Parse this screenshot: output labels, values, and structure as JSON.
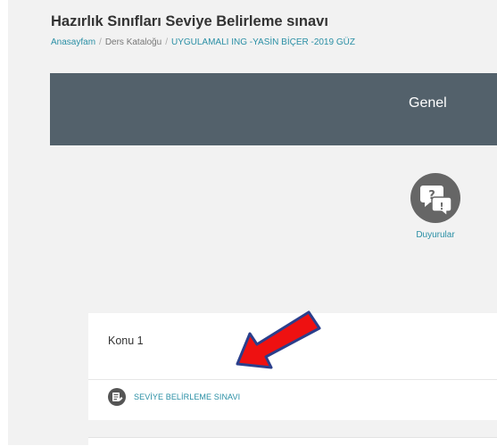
{
  "page": {
    "title": "Hazırlık Sınıfları Seviye Belirleme sınavı"
  },
  "breadcrumb": {
    "items": [
      "Anasayfam",
      "Ders Kataloğu",
      "UYGULAMALI ING -YASİN BİÇER -2019 GÜZ"
    ],
    "separator": "/"
  },
  "tab": {
    "label": "Genel"
  },
  "announcements": {
    "label": "Duyurular",
    "icon": "forum-icon"
  },
  "section": {
    "title": "Konu 1",
    "activity": {
      "label": "SEVİYE BELİRLEME SINAVI",
      "icon": "quiz-icon"
    }
  },
  "colors": {
    "link": "#2a8fa5",
    "banner": "#53616b",
    "page_bg": "#f2f2f2",
    "icon_circle": "#666666",
    "arrow": "#ee1111"
  }
}
